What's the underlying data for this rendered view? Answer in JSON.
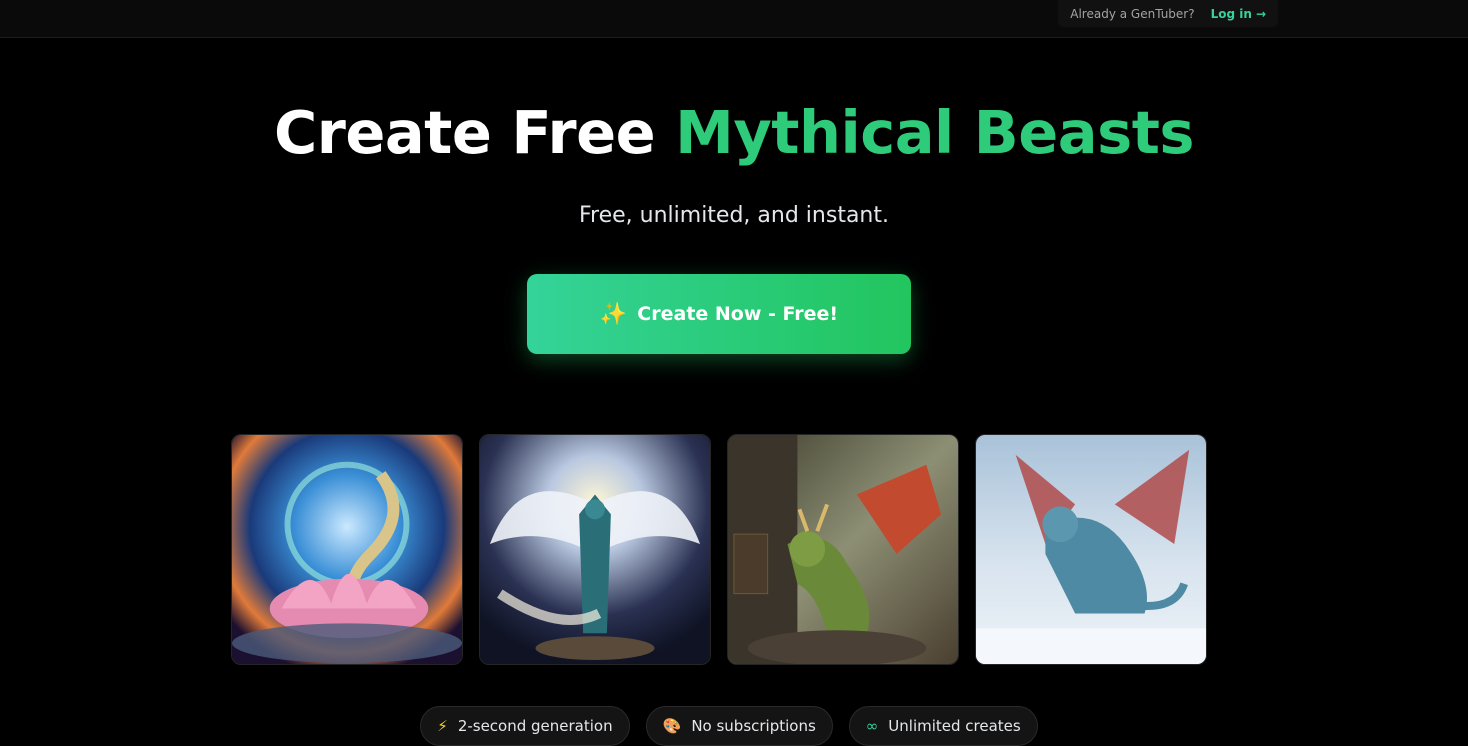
{
  "topbar": {
    "already_text": "Already a GenTuber?",
    "login_label": "Log in",
    "login_arrow": "→"
  },
  "hero": {
    "title_white": "Create Free",
    "title_accent": "Mythical Beasts",
    "subtitle": "Free, unlimited, and instant.",
    "cta_icon": "✨",
    "cta_label": "Create Now - Free!"
  },
  "gallery": [
    {
      "name": "lotus-dragon-image"
    },
    {
      "name": "winged-fox-image"
    },
    {
      "name": "green-dragon-image"
    },
    {
      "name": "ice-dragon-image"
    }
  ],
  "features": [
    {
      "icon": "⚡",
      "icon_name": "lightning-icon",
      "label": "2-second generation"
    },
    {
      "icon": "🎨",
      "icon_name": "palette-icon",
      "label": "No subscriptions"
    },
    {
      "icon": "∞",
      "icon_name": "infinity-icon",
      "label": "Unlimited creates"
    }
  ],
  "colors": {
    "accent": "#2ecc7a",
    "cta_start": "#34d399",
    "cta_end": "#22c55e",
    "background": "#000000"
  }
}
